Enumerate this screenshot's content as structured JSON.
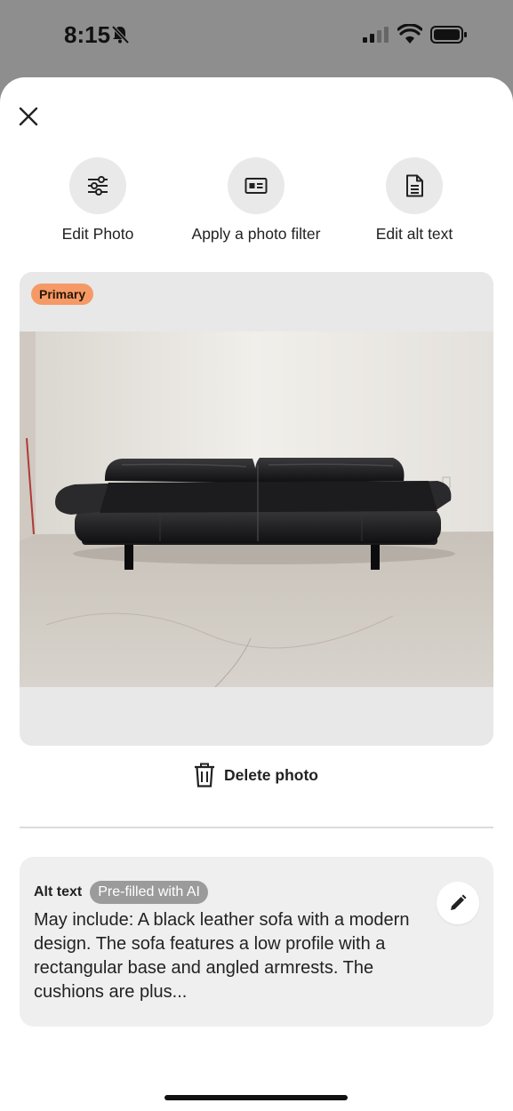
{
  "status_bar": {
    "time": "8:15",
    "icons": [
      "bell-slash-icon",
      "signal-icon",
      "wifi-icon",
      "battery-icon"
    ]
  },
  "actions": [
    {
      "label": "Edit Photo",
      "icon": "sliders-icon"
    },
    {
      "label": "Apply a photo filter",
      "icon": "filter-card-icon"
    },
    {
      "label": "Edit alt text",
      "icon": "document-icon"
    }
  ],
  "photo": {
    "badge": "Primary",
    "subject": "black leather sofa"
  },
  "delete_label": "Delete photo",
  "alt_text": {
    "title": "Alt text",
    "badge": "Pre-filled with AI",
    "body": "May include: A black leather sofa with a modern design. The sofa features a low profile with a rectangular base and angled armrests. The cushions are plus..."
  },
  "colors": {
    "badge_primary": "#f59a66",
    "badge_ai": "#9b9b9b",
    "overlay": "#8e8e8e",
    "card": "#e8e8e8"
  }
}
